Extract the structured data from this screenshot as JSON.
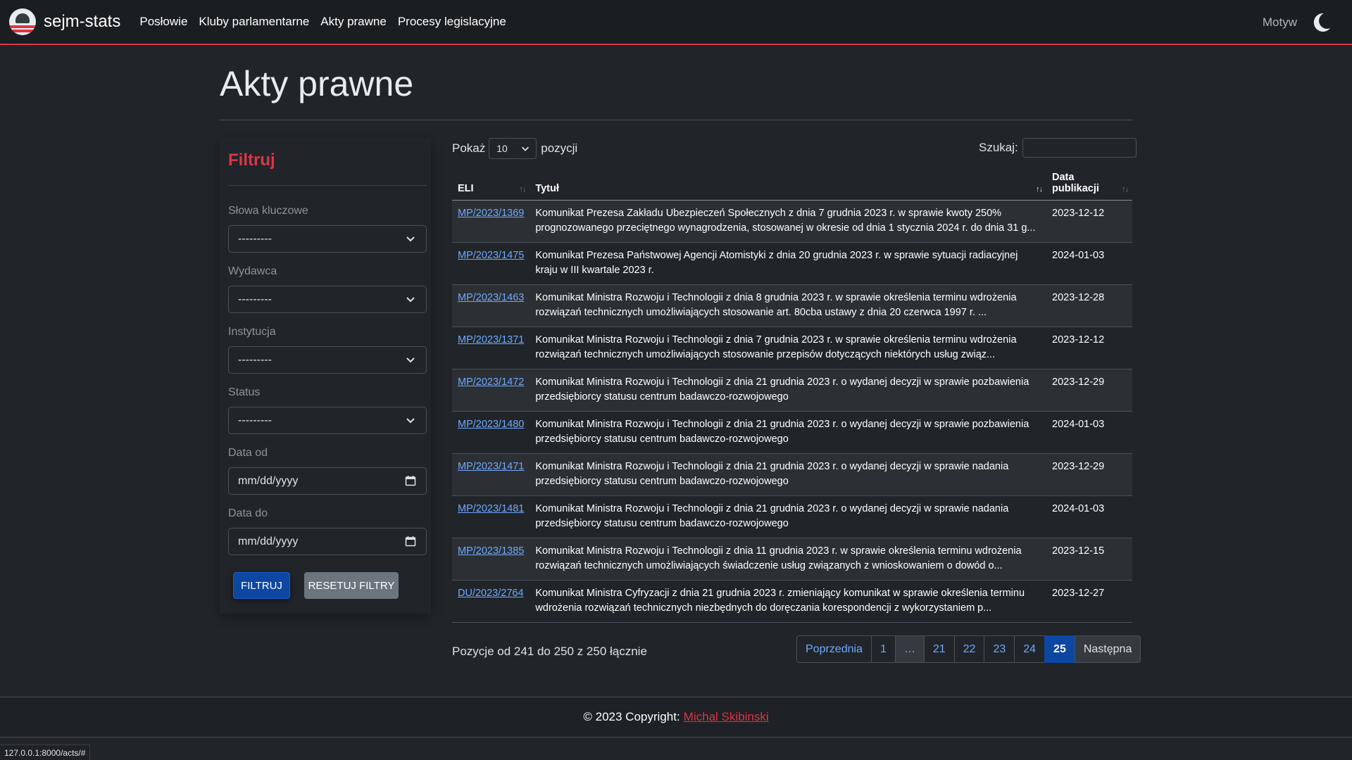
{
  "navbar": {
    "brand": "sejm-stats",
    "links": [
      "Posłowie",
      "Kluby parlamentarne",
      "Akty prawne",
      "Procesy legislacyjne"
    ],
    "theme_label": "Motyw",
    "theme_icon": "moon-icon"
  },
  "page": {
    "title": "Akty prawne"
  },
  "filter": {
    "heading": "Filtruj",
    "fields": [
      {
        "label": "Słowa kluczowe",
        "value": "---------"
      },
      {
        "label": "Wydawca",
        "value": "---------"
      },
      {
        "label": "Instytucja",
        "value": "---------"
      },
      {
        "label": "Status",
        "value": "---------"
      }
    ],
    "date_from": {
      "label": "Data od",
      "placeholder": "mm/dd/yyyy"
    },
    "date_to": {
      "label": "Data do",
      "placeholder": "mm/dd/yyyy"
    },
    "submit_label": "FILTRUJ",
    "reset_label": "RESETUJ FILTRY"
  },
  "table_controls": {
    "show_prefix": "Pokaż",
    "page_length": "10",
    "show_suffix": "pozycji",
    "search_label": "Szukaj:"
  },
  "table": {
    "headers": [
      "ELI",
      "Tytuł",
      "Data publikacji"
    ],
    "rows": [
      {
        "eli": "MP/2023/1369",
        "title": "Komunikat Prezesa Zakładu Ubezpieczeń Społecznych z dnia 7 grudnia 2023 r. w sprawie kwoty 250% prognozowanego przeciętnego wynagrodzenia, stosowanej w okresie od dnia 1 stycznia 2024 r. do dnia 31 g...",
        "date": "2023-12-12"
      },
      {
        "eli": "MP/2023/1475",
        "title": "Komunikat Prezesa Państwowej Agencji Atomistyki z dnia 20 grudnia 2023 r. w sprawie sytuacji radiacyjnej kraju w III kwartale 2023 r.",
        "date": "2024-01-03"
      },
      {
        "eli": "MP/2023/1463",
        "title": "Komunikat Ministra Rozwoju i Technologii z dnia 8 grudnia 2023 r. w sprawie określenia terminu wdrożenia rozwiązań technicznych umożliwiających stosowanie art. 80cba ustawy z dnia 20 czerwca 1997 r. ...",
        "date": "2023-12-28"
      },
      {
        "eli": "MP/2023/1371",
        "title": "Komunikat Ministra Rozwoju i Technologii z dnia 7 grudnia 2023 r. w sprawie określenia terminu wdrożenia rozwiązań technicznych umożliwiających stosowanie przepisów dotyczących niektórych usług związ...",
        "date": "2023-12-12"
      },
      {
        "eli": "MP/2023/1472",
        "title": "Komunikat Ministra Rozwoju i Technologii z dnia 21 grudnia 2023 r. o wydanej decyzji w sprawie pozbawienia przedsiębiorcy statusu centrum badawczo-rozwojowego",
        "date": "2023-12-29"
      },
      {
        "eli": "MP/2023/1480",
        "title": "Komunikat Ministra Rozwoju i Technologii z dnia 21 grudnia 2023 r. o wydanej decyzji w sprawie pozbawienia przedsiębiorcy statusu centrum badawczo-rozwojowego",
        "date": "2024-01-03"
      },
      {
        "eli": "MP/2023/1471",
        "title": "Komunikat Ministra Rozwoju i Technologii z dnia 21 grudnia 2023 r. o wydanej decyzji w sprawie nadania przedsiębiorcy statusu centrum badawczo-rozwojowego",
        "date": "2023-12-29"
      },
      {
        "eli": "MP/2023/1481",
        "title": "Komunikat Ministra Rozwoju i Technologii z dnia 21 grudnia 2023 r. o wydanej decyzji w sprawie nadania przedsiębiorcy statusu centrum badawczo-rozwojowego",
        "date": "2024-01-03"
      },
      {
        "eli": "MP/2023/1385",
        "title": "Komunikat Ministra Rozwoju i Technologii z dnia 11 grudnia 2023 r. w sprawie określenia terminu wdrożenia rozwiązań technicznych umożliwiających świadczenie usług związanych z wnioskowaniem o dowód o...",
        "date": "2023-12-15"
      },
      {
        "eli": "DU/2023/2764",
        "title": "Komunikat Ministra Cyfryzacji z dnia 21 grudnia 2023 r. zmieniający komunikat w sprawie określenia terminu wdrożenia rozwiązań technicznych niezbędnych do doręczania korespondencji z wykorzystaniem p...",
        "date": "2023-12-27"
      }
    ]
  },
  "info": "Pozycje od 241 do 250 z 250 łącznie",
  "pagination": {
    "prev": "Poprzednia",
    "pages": [
      "1",
      "…",
      "21",
      "22",
      "23",
      "24",
      "25"
    ],
    "active": "25",
    "next": "Następna"
  },
  "footer": {
    "text": "© 2023 Copyright:",
    "author": "Michal Skibinski"
  },
  "status_url": "127.0.0.1:8000/acts/#",
  "colors": {
    "accent": "#dc3545",
    "primary": "#0d47a1",
    "link": "#6ea8fe",
    "background": "#212529"
  }
}
